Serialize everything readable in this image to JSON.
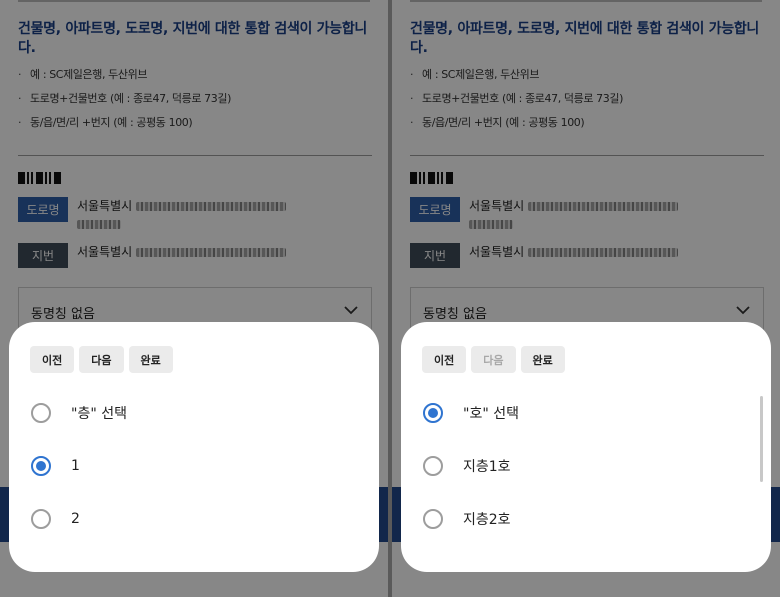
{
  "background": {
    "heading": "건물명, 아파트명, 도로명, 지번에 대한 통합 검색이 가능합니다.",
    "tips": [
      "예 : SC제일은행, 두산위브",
      "도로명+건물번호 (예 : 종로47, 덕릉로 73길)",
      "동/읍/면/리 +번지 (예 : 공평동 100)"
    ],
    "road_tag": "도로명",
    "jibun_tag": "지번",
    "road_addr_prefix": "서울특별시",
    "jibun_addr_prefix": "서울특별시",
    "select_value": "동명칭 없음"
  },
  "panels": [
    {
      "buttons": {
        "prev": "이전",
        "next": "다음",
        "done": "완료"
      },
      "next_enabled": true,
      "options": [
        {
          "label": "\"층\" 선택",
          "selected": false
        },
        {
          "label": "1",
          "selected": true
        },
        {
          "label": "2",
          "selected": false
        }
      ]
    },
    {
      "buttons": {
        "prev": "이전",
        "next": "다음",
        "done": "완료"
      },
      "next_enabled": false,
      "options": [
        {
          "label": "\"호\" 선택",
          "selected": true
        },
        {
          "label": "지층1호",
          "selected": false
        },
        {
          "label": "지층2호",
          "selected": false
        }
      ]
    }
  ],
  "colors": {
    "accent": "#2f74d0",
    "heading": "#1a3f86",
    "road_tag": "#2e5fa9",
    "jibun_tag": "#3f4d5a",
    "bar": "#224a8e"
  }
}
